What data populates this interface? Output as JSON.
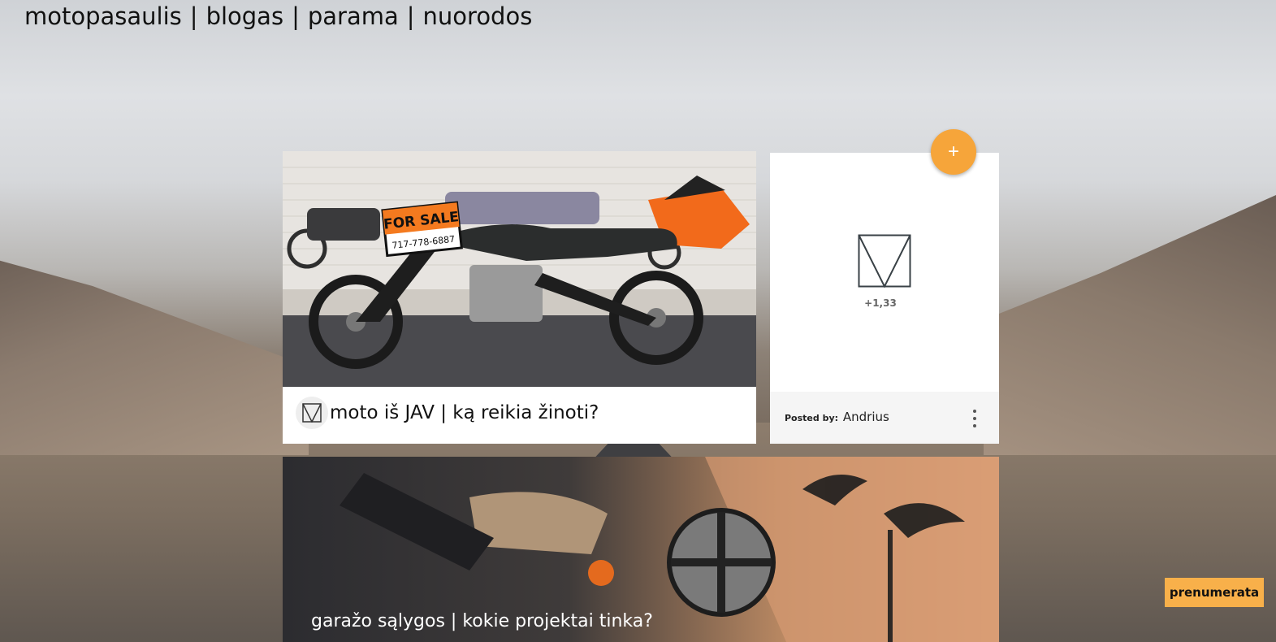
{
  "nav": {
    "items": [
      "motopasaulis",
      "blogas",
      "parama",
      "nuorodos"
    ],
    "separator": "|"
  },
  "post1": {
    "title": "moto iš JAV | ką reikia  žinoti?",
    "image_sign_text": "FOR SALE",
    "image_phone_text": "717-778-6887"
  },
  "side": {
    "count": "+1,33",
    "posted_by_label": "Posted by:",
    "author": "Andrius"
  },
  "fab": {
    "label": "+"
  },
  "post2": {
    "title": "garažo sąlygos | kokie projektai tinka?"
  },
  "subscribe": {
    "label": "prenumerata"
  },
  "colors": {
    "accent": "#f6a53a",
    "subscribe": "#f8b04a"
  },
  "icons": [
    "triangle-square-icon",
    "more-vert-icon",
    "plus-icon"
  ]
}
